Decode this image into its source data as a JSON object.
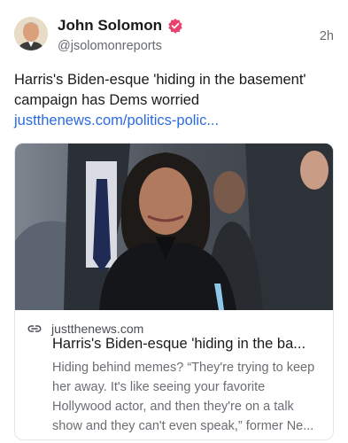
{
  "author": {
    "name": "John Solomon",
    "handle": "@jsolomonreports",
    "verified_badge_color": "#e8416d"
  },
  "post": {
    "time": "2h",
    "text_lines": [
      "Harris's Biden-esque 'hiding in the basement'",
      "campaign has Dems worried"
    ],
    "link": "justthenews.com/politics-polic..."
  },
  "link_card": {
    "domain": "justthenews.com",
    "title": "Harris's Biden-esque 'hiding in the ba...",
    "description_lines": [
      "Hiding behind memes? “They're trying to keep",
      "her away. It's like seeing your favorite",
      "Hollywood actor, and then they're on a talk",
      "show and they can't even speak,” former Ne..."
    ]
  },
  "colors": {
    "link": "#2b6be0",
    "secondary_text": "#666a70"
  }
}
